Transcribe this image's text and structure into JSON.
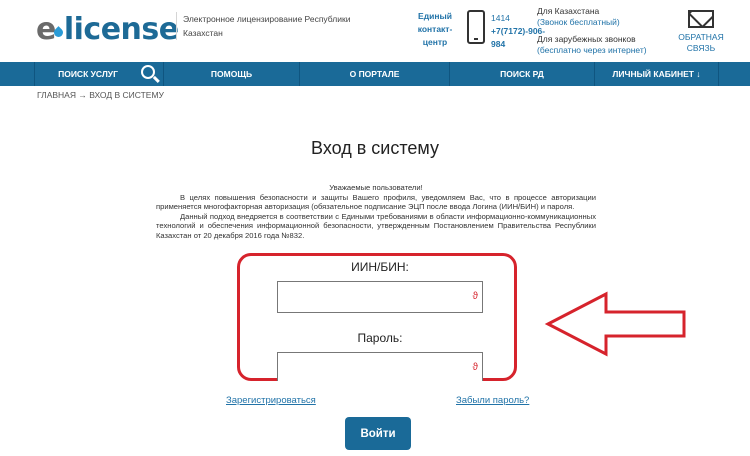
{
  "header": {
    "logo_e": "e",
    "logo_rest": "license",
    "tagline": "Электронное лицензирование Республики Казахстан",
    "contact_center": "Единый контакт-центр",
    "phone_short": "1414",
    "phone_long": "+7(7172)-906-984",
    "kz_label": "Для Казахстана",
    "kz_note": "(Звонок бесплатный)",
    "intl_label": "Для зарубежных звонков",
    "intl_note": "(бесплатно через интернет)",
    "feedback": "ОБРАТНАЯ СВЯЗЬ"
  },
  "nav": {
    "items": [
      {
        "label": "ПОИСК УСЛУГ"
      },
      {
        "label": "ПОМОЩЬ"
      },
      {
        "label": "О ПОРТАЛЕ"
      },
      {
        "label": "ПОИСК РД"
      },
      {
        "label": "ЛИЧНЫЙ КАБИНЕТ ↓"
      }
    ]
  },
  "breadcrumb": {
    "home": "ГЛАВНАЯ",
    "sep": " → ",
    "current": "ВХОД В СИСТЕМУ"
  },
  "page": {
    "title": "Вход в систему",
    "notice_greeting": "Уважаемые пользователи!",
    "notice_p1": "В целях повышения безопасности и защиты Вашего профиля, уведомляем Вас, что в процессе авторизации применяется многофакторная авторизация (обязательное подписание ЭЦП после ввода Логина (ИИН/БИН) и пароля.",
    "notice_p2": "Данный подход внедряется в соответствии с Едиными требованиями в области информационно-коммуникационных технологий и обеспечения информационной безопасности, утвержденным Постановлением Правительства Республики Казахстан от 20 декабря 2016 года №832."
  },
  "form": {
    "iin_label": "ИИН/БИН:",
    "iin_value": "",
    "password_label": "Пароль:",
    "password_value": "",
    "field_icon_glyph": "ϑ",
    "register_link": "Зарегистрироваться",
    "forgot_link": "Забыли пароль?",
    "login_button": "Войти"
  },
  "colors": {
    "brand_blue": "#1a6a98",
    "link_blue": "#2173a8",
    "highlight_red": "#d6232c"
  }
}
